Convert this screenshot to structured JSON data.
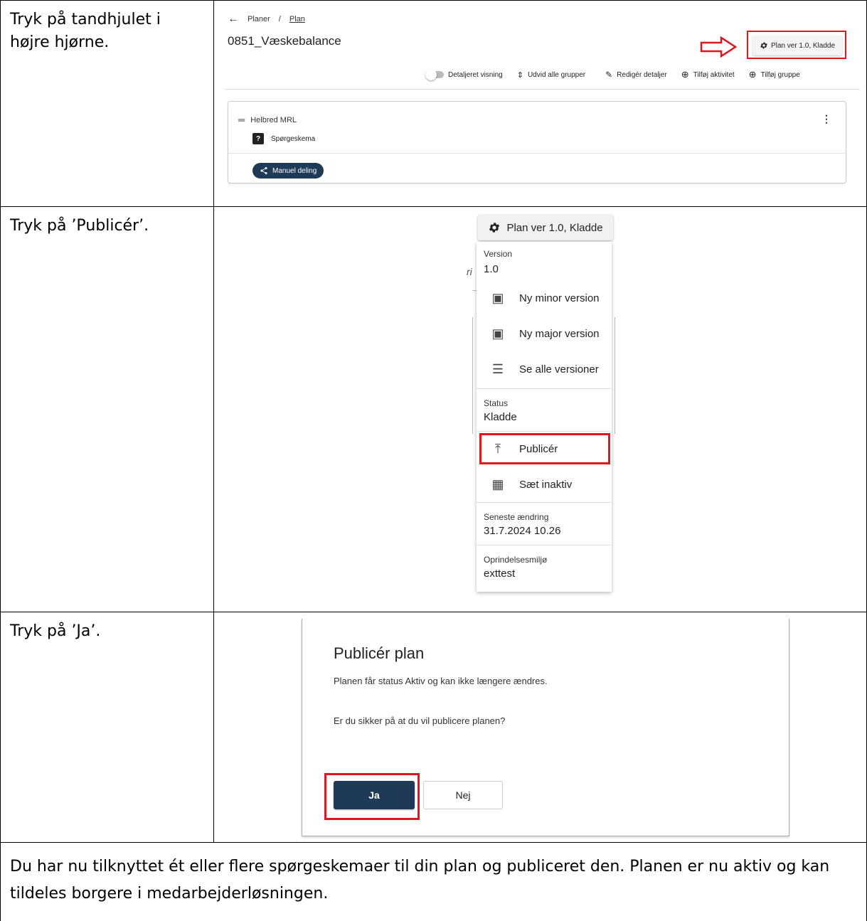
{
  "steps": [
    {
      "instruction": "Tryk på tandhjulet i højre hjørne."
    },
    {
      "instruction": "Tryk på ’Publicér’."
    },
    {
      "instruction": "Tryk på ’Ja’."
    }
  ],
  "footer": "Du har nu tilknyttet ét eller flere spørgeskemaer til din plan og publiceret den. Planen er nu aktiv og kan tildeles borgere i medarbejderløsningen.",
  "shot1": {
    "breadcrumb": {
      "back_icon": "arrow-left-icon",
      "root": "Planer",
      "separator": "/",
      "current": "Plan"
    },
    "plan_title": "0851_Væskebalance",
    "plan_button": "Plan ver 1.0, Kladde",
    "toolbar": {
      "detail_view": "Detaljeret visning",
      "expand_groups": "Udvid alle grupper",
      "edit_details": "Redigér detaljer",
      "add_activity": "Tilføj aktivitet",
      "add_group": "Tilføj gruppe"
    },
    "group": {
      "title": "Helbred MRL",
      "item": "Spørgeskema",
      "share": "Manuel deling"
    },
    "highlight_color": "#e0161e",
    "accent_color": "#1f3a56"
  },
  "shot2": {
    "plan_button": "Plan ver 1.0, Kladde",
    "ghost_char": "ri",
    "menu": {
      "version_label": "Version",
      "version_value": "1.0",
      "new_minor": "Ny minor version",
      "new_major": "Ny major version",
      "all_versions": "Se alle versioner",
      "status_label": "Status",
      "status_value": "Kladde",
      "publish": "Publicér",
      "set_inactive": "Sæt inaktiv",
      "last_change_label": "Seneste ændring",
      "last_change_value": "31.7.2024 10.26",
      "origin_label": "Oprindelsesmiljø",
      "origin_value": "exttest"
    }
  },
  "shot3": {
    "title": "Publicér plan",
    "text1": "Planen får status Aktiv og kan ikke længere ændres.",
    "text2": "Er du sikker på at du vil publicere planen?",
    "yes": "Ja",
    "no": "Nej"
  }
}
